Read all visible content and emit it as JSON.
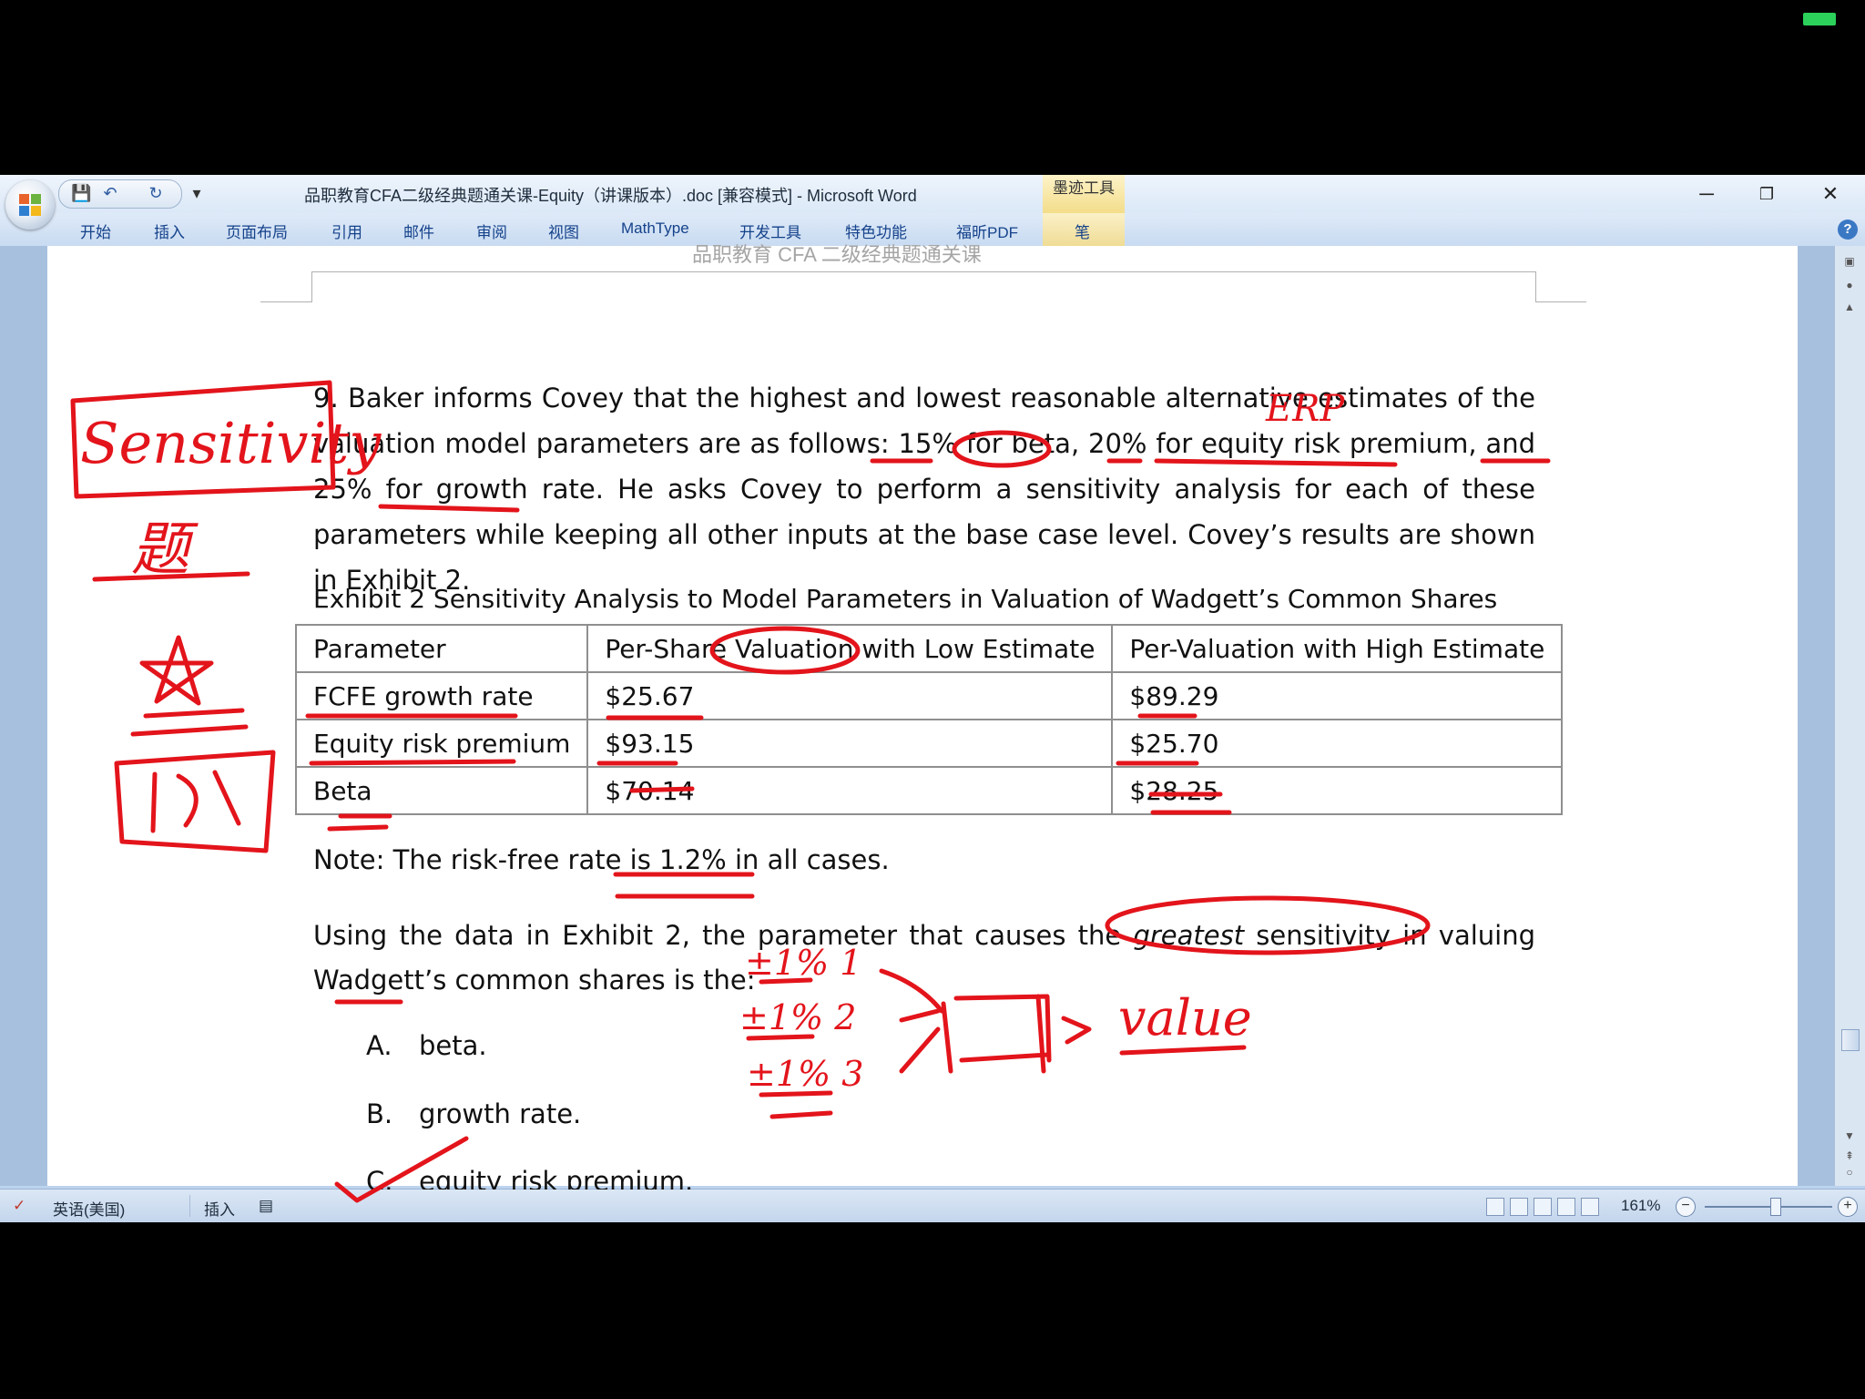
{
  "window": {
    "title": "品职教育CFA二级经典题通关课-Equity（讲课版本）.doc [兼容模式] - Microsoft Word",
    "contextual_tab": "墨迹工具",
    "controls": {
      "minimize": "─",
      "restore": "❐",
      "close": "✕"
    }
  },
  "qat": {
    "save": "💾",
    "undo": "↶",
    "redo": "↻",
    "customize": "▾"
  },
  "ribbon": {
    "tabs": [
      "开始",
      "插入",
      "页面布局",
      "引用",
      "邮件",
      "审阅",
      "视图",
      "MathType",
      "开发工具",
      "特色功能",
      "福昕PDF",
      "笔"
    ],
    "help": "?"
  },
  "document": {
    "running_header": "品职教育 CFA 二级经典题通关课",
    "paragraph": "9. Baker informs Covey that the highest and lowest reasonable alternative estimates of the valuation model parameters are as follows: 15% for beta, 20% for equity risk premium, and 25% for growth rate. He asks Covey to perform a sensitivity analysis for each of these parameters while keeping all other inputs at the base case level. Covey’s results are shown in Exhibit 2.",
    "exhibit_caption": "Exhibit 2 Sensitivity Analysis to Model Parameters in Valuation of Wadgett’s Common Shares",
    "table": {
      "headers": [
        "Parameter",
        "Per-Share Valuation with Low Estimate",
        "Per-Valuation with High Estimate"
      ],
      "rows": [
        [
          "FCFE growth rate",
          "$25.67",
          "$89.29"
        ],
        [
          "Equity risk premium",
          "$93.15",
          "$25.70"
        ],
        [
          "Beta",
          "$70.14",
          "$28.25"
        ]
      ]
    },
    "note": "Note: The risk-free rate is 1.2% in all cases.",
    "question_before": "Using the data in Exhibit 2, the parameter that causes the ",
    "question_emphasis": "greatest",
    "question_after": " sensitivity in valuing Wadgett’s common shares is the:",
    "options": [
      {
        "letter": "A.",
        "text": "beta."
      },
      {
        "letter": "B.",
        "text": "growth rate."
      },
      {
        "letter": "C.",
        "text": "equity risk premium."
      }
    ]
  },
  "annotations": {
    "sensitivity_box": "Sensitivity",
    "label_topic": "题",
    "label_ERP": "ERP",
    "label_value": "value",
    "label_b1": "±1% 1",
    "label_b2": "±1% 2",
    "label_b3": "±1% 3",
    "ink_color": "#e3141b"
  },
  "status_bar": {
    "language": "英语(美国)",
    "mode": "插入",
    "zoom": "161%",
    "zoom_minus": "−",
    "zoom_plus": "+"
  }
}
